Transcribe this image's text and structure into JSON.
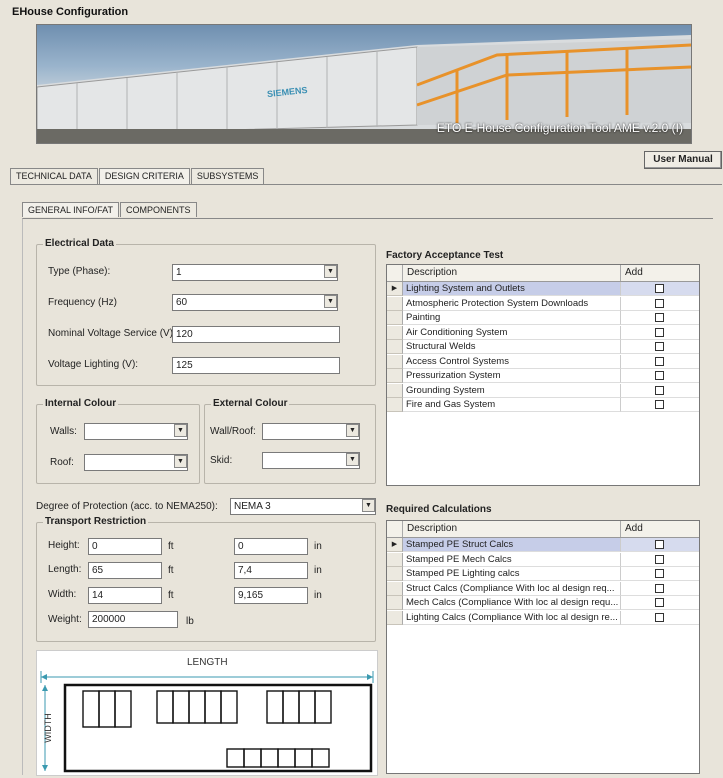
{
  "app": {
    "title": "EHouse Configuration",
    "banner_caption": "ETO E-House Configuration Tool AME v.2.0 (I)",
    "banner_logo": "SIEMENS",
    "user_manual_label": "User Manual"
  },
  "tabs": [
    "TECHNICAL DATA",
    "DESIGN CRITERIA",
    "SUBSYSTEMS"
  ],
  "subtabs": [
    "GENERAL INFO/FAT",
    "COMPONENTS"
  ],
  "electrical": {
    "title": "Electrical Data",
    "type_label": "Type (Phase):",
    "type_value": "1",
    "freq_label": "Frequency (Hz)",
    "freq_value": "60",
    "nominal_label": "Nominal Voltage Service (V):",
    "nominal_value": "120",
    "lighting_label": "Voltage Lighting (V):",
    "lighting_value": "125"
  },
  "internal_colour": {
    "title": "Internal Colour",
    "walls_label": "Walls:",
    "walls_value": "",
    "roof_label": "Roof:",
    "roof_value": ""
  },
  "external_colour": {
    "title": "External Colour",
    "wallroof_label": "Wall/Roof:",
    "wallroof_value": "",
    "skid_label": "Skid:",
    "skid_value": ""
  },
  "protection": {
    "label": "Degree of Protection (acc. to NEMA250):",
    "value": "NEMA 3"
  },
  "transport": {
    "title": "Transport Restriction",
    "height_label": "Height:",
    "height_ft": "0",
    "height_in": "0",
    "length_label": "Length:",
    "length_ft": "65",
    "length_in": "7,4",
    "width_label": "Width:",
    "width_ft": "14",
    "width_in": "9,165",
    "weight_label": "Weight:",
    "weight_value": "200000",
    "unit_ft": "ft",
    "unit_in": "in",
    "unit_lb": "lb"
  },
  "diagram": {
    "length_label": "LENGTH",
    "width_label": "WIDTH"
  },
  "fat": {
    "title": "Factory Acceptance Test",
    "col_desc": "Description",
    "col_add": "Add",
    "rows": [
      "Lighting System and Outlets",
      "Atmospheric Protection System Downloads",
      "Painting",
      "Air Conditioning System",
      "Structural Welds",
      "Access Control Systems",
      "Pressurization System",
      "Grounding System",
      "Fire and Gas System"
    ]
  },
  "calcs": {
    "title": "Required Calculations",
    "col_desc": "Description",
    "col_add": "Add",
    "rows": [
      "Stamped PE Struct Calcs",
      "Stamped PE Mech Calcs",
      "Stamped PE Lighting calcs",
      "Struct Calcs (Compliance With loc al design req...",
      "Mech Calcs (Compliance With loc al design requ...",
      "Lighting Calcs (Compliance With loc al design re..."
    ]
  },
  "colors": {
    "selected_row": "#c6cde8",
    "window_bg": "#e8e4da",
    "rail": "#e8922a"
  }
}
